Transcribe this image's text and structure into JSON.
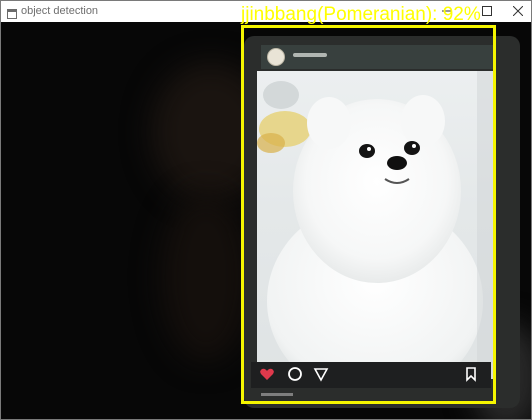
{
  "window": {
    "title": "object detection",
    "buttons": {
      "minimize": "minimize-icon",
      "maximize": "maximize-icon",
      "close": "close-icon"
    }
  },
  "detection": {
    "label": "jjinbbang(Pomeranian): 92%",
    "box_color": "#f5f500",
    "label_color": "#ffff00"
  },
  "scene": {
    "phone_screen_icons": [
      "heart-icon",
      "comment-icon",
      "send-icon",
      "bookmark-icon"
    ],
    "accent_heart": "#e0394c"
  }
}
